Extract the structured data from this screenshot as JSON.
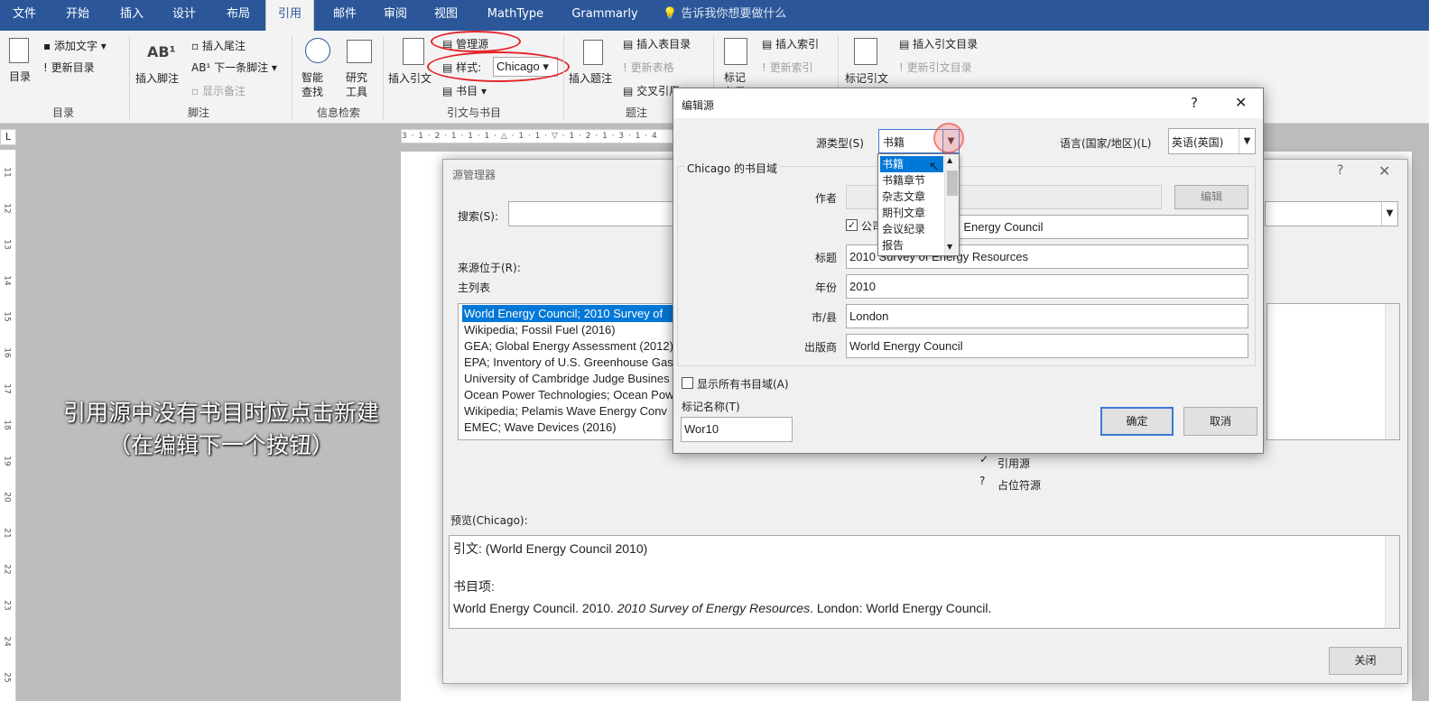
{
  "tabs": [
    "文件",
    "开始",
    "插入",
    "设计",
    "布局",
    "引用",
    "邮件",
    "审阅",
    "视图",
    "MathType",
    "Grammarly"
  ],
  "tell_me": "告诉我你想要做什么",
  "ribbon": {
    "toc": {
      "big": "目录",
      "add_text": "添加文字",
      "update": "更新目录",
      "group": "目录"
    },
    "footnote": {
      "insert": "插入脚注",
      "insert_endnote": "插入尾注",
      "next": "下一条脚注",
      "show": "显示备注",
      "group": "脚注"
    },
    "research": {
      "smart": "智能\n查找",
      "researcher": "研究\n工具",
      "group": "信息检索"
    },
    "citations": {
      "insert": "插入引文",
      "manage": "管理源",
      "style_label": "样式:",
      "style_value": "Chicago",
      "bibliography": "书目",
      "group": "引文与书目"
    },
    "captions": {
      "insert": "插入题注",
      "table_of_figures": "插入表目录",
      "update_table": "更新表格",
      "cross_ref": "交叉引用",
      "group": "题注"
    },
    "index": {
      "mark": "标记\n条目",
      "insert": "插入索引",
      "update": "更新索引"
    },
    "toa": {
      "mark": "标记引文",
      "insert": "插入引文目录",
      "update": "更新引文目录"
    }
  },
  "ruler": "3 · 1 · 2 · 1 · 1 · 1 · △ · 1 · 1 · ▽ · 1 · 2 · 1 · 3 · 1 · 4",
  "vruler_nums": [
    "11",
    "12",
    "13",
    "14",
    "15",
    "16",
    "17",
    "18",
    "19",
    "20",
    "21",
    "22",
    "23",
    "24",
    "25"
  ],
  "caption": [
    "引用源中没有书目时应点击新建",
    "（在编辑下一个按钮）"
  ],
  "source_manager": {
    "title": "源管理器",
    "search_label": "搜索(S):",
    "sources_label": "来源位于(R):",
    "master_list": "主列表",
    "sources": [
      "World Energy Council; 2010 Survey of",
      "Wikipedia; Fossil Fuel (2016)",
      "GEA; Global Energy Assessment (2012)",
      "EPA; Inventory of U.S. Greenhouse Gas",
      "University of Cambridge Judge Busines",
      "Ocean Power Technologies; Ocean Pow",
      "Wikipedia; Pelamis Wave Energy Conv",
      "EMEC; Wave Devices (2016)"
    ],
    "legend_cited": "引用源",
    "legend_placeholder": "占位符源",
    "preview_label": "预览(Chicago):",
    "preview_citation": "引文: (World Energy Council 2010)",
    "preview_bib_label": "书目项:",
    "preview_bib_1": "World Energy Council. 2010. ",
    "preview_bib_title": "2010 Survey of Energy Resources",
    "preview_bib_2": ". London: World Energy Council.",
    "close_btn": "关闭"
  },
  "edit_source": {
    "title": "编辑源",
    "help": "?",
    "close": "✕",
    "type_label": "源类型(S)",
    "type_value": "书籍",
    "lang_label": "语言(国家/地区)(L)",
    "lang_value": "英语(英国)",
    "fields_heading": "Chicago 的书目域",
    "author_label": "作者",
    "edit_btn": "编辑",
    "corp_label": "公司作者",
    "corp_value": "World Energy Council",
    "title_label": "标题",
    "title_value": "2010 Survey of Energy Resources",
    "year_label": "年份",
    "year_value": "2010",
    "city_label": "市/县",
    "city_value": "London",
    "publisher_label": "出版商",
    "publisher_value": "World Energy Council",
    "show_all": "显示所有书目域(A)",
    "tag_label": "标记名称(T)",
    "tag_value": "Wor10",
    "ok": "确定",
    "cancel": "取消",
    "type_options": [
      "书籍",
      "书籍章节",
      "杂志文章",
      "期刊文章",
      "会议纪录",
      "报告"
    ]
  }
}
